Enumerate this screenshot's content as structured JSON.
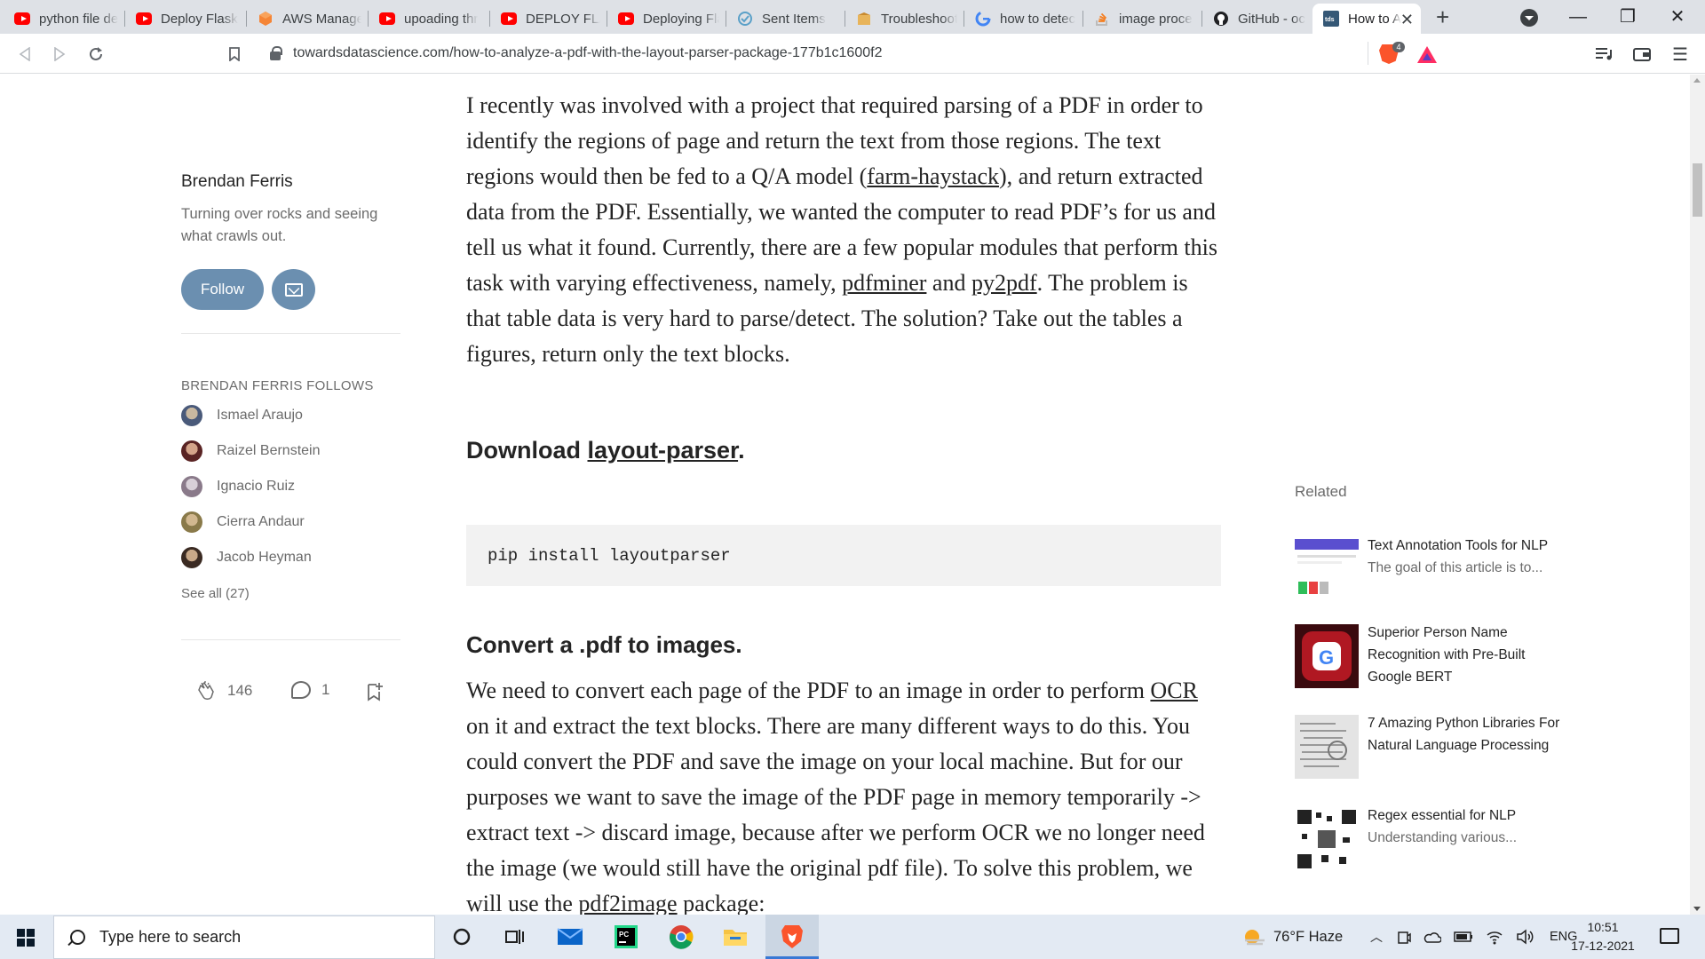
{
  "browser": {
    "tabs": [
      {
        "title": "python file de",
        "favicon": "youtube-icon"
      },
      {
        "title": "Deploy Flask",
        "favicon": "youtube-icon"
      },
      {
        "title": "AWS Manage",
        "favicon": "aws-icon"
      },
      {
        "title": "upoading thr",
        "favicon": "youtube-icon"
      },
      {
        "title": "DEPLOY FLAS",
        "favicon": "youtube-icon"
      },
      {
        "title": "Deploying Fla",
        "favicon": "youtube-icon"
      },
      {
        "title": "Sent Items",
        "favicon": "outlook-icon"
      },
      {
        "title": "Troubleshoot",
        "favicon": "box-icon"
      },
      {
        "title": "how to detec",
        "favicon": "google-icon"
      },
      {
        "title": "image proce",
        "favicon": "stackoverflow-icon"
      },
      {
        "title": "GitHub - ocr",
        "favicon": "github-icon"
      },
      {
        "title": "How to A",
        "favicon": "tds-icon"
      }
    ],
    "url": "towardsdatascience.com/how-to-analyze-a-pdf-with-the-layout-parser-package-177b1c1600f2",
    "shield_count": "4"
  },
  "author": {
    "name": "Brendan Ferris",
    "bio": "Turning over rocks and seeing what crawls out.",
    "follow_label": "Follow",
    "follows_heading": "BRENDAN FERRIS FOLLOWS",
    "follows": [
      {
        "name": "Ismael Araujo",
        "color": "#4a5a7a"
      },
      {
        "name": "Raizel Bernstein",
        "color": "#7a3a3a"
      },
      {
        "name": "Ignacio Ruiz",
        "color": "#8a8a9a"
      },
      {
        "name": "Cierra Andaur",
        "color": "#9a8a5a"
      },
      {
        "name": "Jacob Heyman",
        "color": "#5a4a3a"
      }
    ],
    "see_all": "See all (27)",
    "claps": "146",
    "responses": "1"
  },
  "article": {
    "para1": [
      {
        "t": "I recently was involved with a project that required parsing of a PDF in order to identify the regions of page and return the text from those regions. The text regions would then be fed to a Q/A model ("
      },
      {
        "t": "farm-haystack",
        "link": true
      },
      {
        "t": "), and return extracted data from the PDF. Essentially, we wanted the computer to read PDF’s for us and tell us what it found. Currently, there are a few popular modules that perform this task with varying effectiveness, namely, "
      },
      {
        "t": "pdfminer",
        "link": true
      },
      {
        "t": " and "
      },
      {
        "t": "py2pdf",
        "link": true
      },
      {
        "t": ". The problem is that table data is very hard to parse/detect. The solution? Take out the tables a figures, return only the text blocks."
      }
    ],
    "download_heading_pre": "Download ",
    "download_heading_link": "layout-parser",
    "download_heading_post": ".",
    "code": "pip install layoutparser",
    "convert_heading": "Convert a .pdf to images.",
    "para2": [
      {
        "t": "We need to convert each page of the PDF to an image in order to perform "
      },
      {
        "t": "OCR",
        "link": true
      },
      {
        "t": " on it and extract the text blocks. There are many different ways to do this. You could convert the PDF and save the image on your local machine. But for our purposes we want to save the image of the PDF page in memory temporarily -> extract text -> discard image, because after we perform OCR we no longer need the image (we would still have the original pdf file). To solve this problem, we will use the "
      },
      {
        "t": "pdf2image",
        "link": true
      },
      {
        "t": " package:"
      }
    ]
  },
  "related": {
    "heading": "Related",
    "items": [
      {
        "title": "Text Annotation Tools for NLP",
        "subtitle": "The goal of this article is to...",
        "thumb": "annotation-thumb"
      },
      {
        "title": "Superior Person Name Recognition with Pre-Built Google BERT",
        "subtitle": "",
        "thumb": "google-thumb"
      },
      {
        "title": "7 Amazing Python Libraries For Natural Language Processing",
        "subtitle": "",
        "thumb": "paper-thumb"
      },
      {
        "title": "Regex essential for NLP",
        "subtitle": "Understanding various...",
        "thumb": "qr-thumb"
      }
    ]
  },
  "taskbar": {
    "search_placeholder": "Type here to search",
    "weather": "76°F  Haze",
    "language": "ENG",
    "time": "10:51",
    "date": "17-12-2021"
  }
}
